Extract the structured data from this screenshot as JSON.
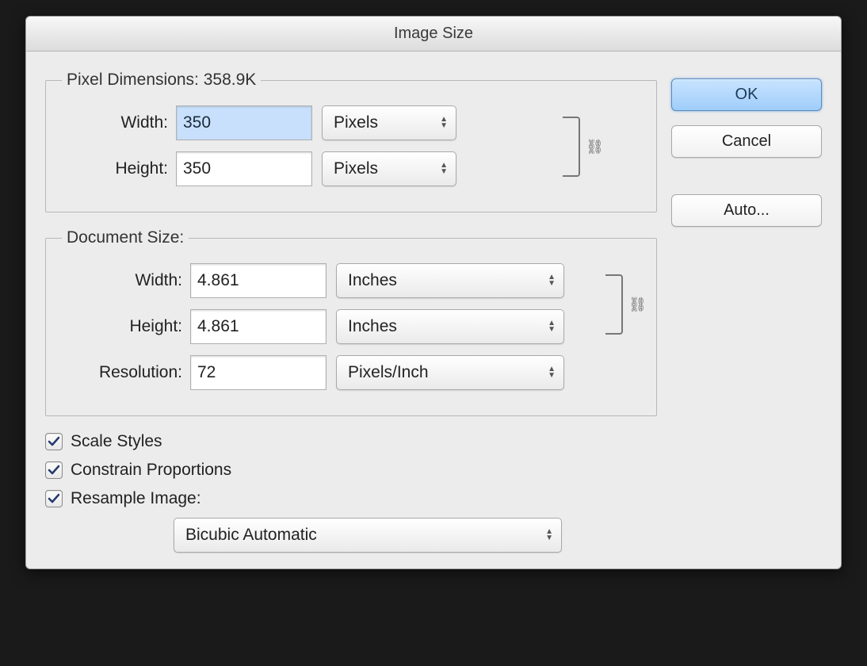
{
  "dialog": {
    "title": "Image Size"
  },
  "buttons": {
    "ok": "OK",
    "cancel": "Cancel",
    "auto": "Auto..."
  },
  "pixelDimensions": {
    "legend": "Pixel Dimensions:  358.9K",
    "widthLabel": "Width:",
    "widthValue": "350",
    "widthUnit": "Pixels",
    "heightLabel": "Height:",
    "heightValue": "350",
    "heightUnit": "Pixels"
  },
  "documentSize": {
    "legend": "Document Size:",
    "widthLabel": "Width:",
    "widthValue": "4.861",
    "widthUnit": "Inches",
    "heightLabel": "Height:",
    "heightValue": "4.861",
    "heightUnit": "Inches",
    "resolutionLabel": "Resolution:",
    "resolutionValue": "72",
    "resolutionUnit": "Pixels/Inch"
  },
  "checkboxes": {
    "scaleStyles": "Scale Styles",
    "constrainProportions": "Constrain Proportions",
    "resampleImage": "Resample Image:"
  },
  "resample": {
    "method": "Bicubic Automatic"
  }
}
